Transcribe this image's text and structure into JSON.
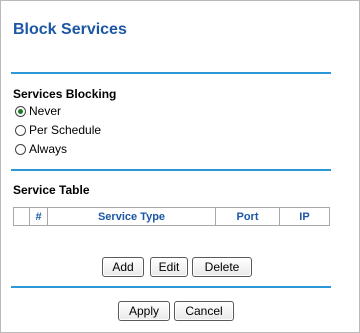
{
  "page": {
    "title": "Block Services"
  },
  "blocking": {
    "heading": "Services Blocking",
    "options": [
      {
        "label": "Never",
        "checked": true
      },
      {
        "label": "Per Schedule",
        "checked": false
      },
      {
        "label": "Always",
        "checked": false
      }
    ]
  },
  "service_table": {
    "heading": "Service Table",
    "columns": [
      "",
      "#",
      "Service Type",
      "Port",
      "IP"
    ],
    "rows": []
  },
  "table_buttons": {
    "add": "Add",
    "edit": "Edit",
    "delete": "Delete"
  },
  "form_buttons": {
    "apply": "Apply",
    "cancel": "Cancel"
  },
  "colors": {
    "title": "#1c57a5",
    "rule": "#2a98d6",
    "header_text": "#1c57a5"
  }
}
